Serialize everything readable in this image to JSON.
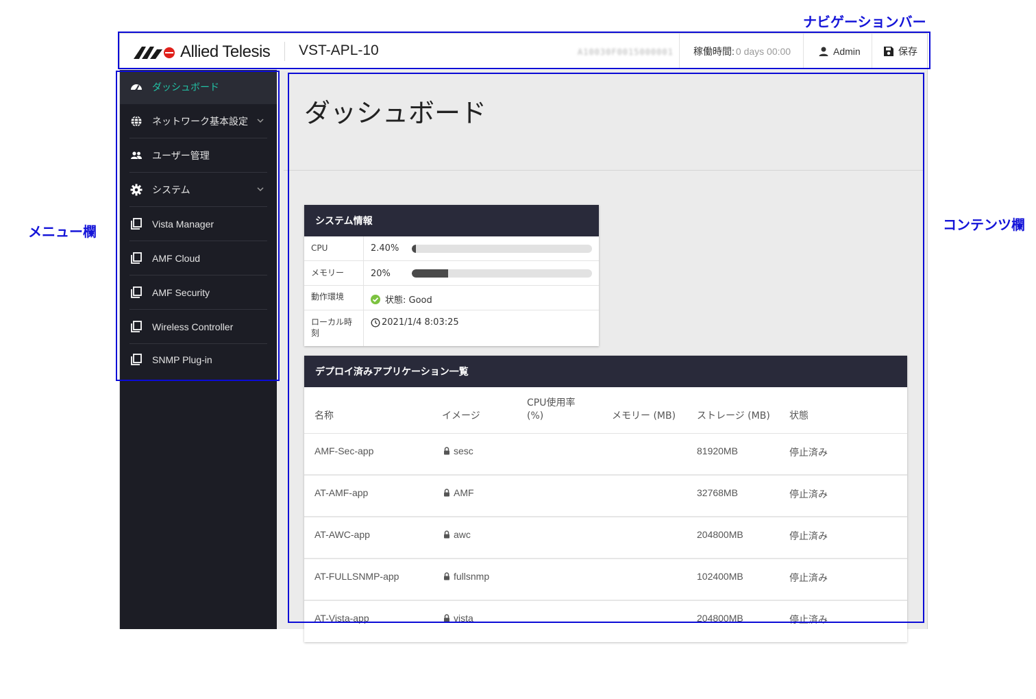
{
  "annotations": {
    "navbar_label": "ナビゲーションバー",
    "menu_label": "メニュー欄",
    "content_label": "コンテンツ欄"
  },
  "colors": {
    "accent": "#22c3a6",
    "sidebar_bg": "#1c1d25",
    "card_header": "#292a3a",
    "annotation": "#0a0ad6",
    "logo_red": "#e0201b"
  },
  "topbar": {
    "logo_text": "Allied Telesis",
    "device_name": "VST-APL-10",
    "serial": "A10030F0015000001",
    "uptime_label": "稼働時間:",
    "uptime_value": "0 days 00:00",
    "user_label": "Admin",
    "user_icon": "user-icon",
    "save_label": "保存",
    "save_icon": "floppy-disk-icon"
  },
  "sidebar": {
    "items": [
      {
        "label": "ダッシュボード",
        "icon": "speedometer-icon",
        "active": true
      },
      {
        "label": "ネットワーク基本設定",
        "icon": "globe-icon",
        "expandable": true
      },
      {
        "label": "ユーザー管理",
        "icon": "users-icon"
      },
      {
        "label": "システム",
        "icon": "gear-icon",
        "expandable": true
      },
      {
        "label": "Vista Manager",
        "icon": "app-window-icon"
      },
      {
        "label": "AMF Cloud",
        "icon": "app-window-icon"
      },
      {
        "label": "AMF Security",
        "icon": "app-window-icon"
      },
      {
        "label": "Wireless Controller",
        "icon": "app-window-icon"
      },
      {
        "label": "SNMP Plug-in",
        "icon": "app-window-icon"
      }
    ]
  },
  "main": {
    "title": "ダッシュボード",
    "system_info": {
      "title": "システム情報",
      "cpu_label": "CPU",
      "cpu_value": "2.40%",
      "cpu_fraction": 0.024,
      "memory_label": "メモリー",
      "memory_value": "20%",
      "memory_fraction": 0.2,
      "env_label": "動作環境",
      "env_value": "状態: Good",
      "time_label": "ローカル時刻",
      "time_value": "2021/1/4 8:03:25"
    },
    "apps": {
      "title": "デプロイ済みアプリケーション一覧",
      "columns": [
        "名称",
        "イメージ",
        "CPU使用率 (%)",
        "メモリー (MB)",
        "ストレージ (MB)",
        "状態"
      ],
      "rows": [
        {
          "name": "AMF-Sec-app",
          "image": "sesc",
          "cpu": "",
          "memory": "",
          "storage": "81920MB",
          "status": "停止済み"
        },
        {
          "name": "AT-AMF-app",
          "image": "AMF",
          "cpu": "",
          "memory": "",
          "storage": "32768MB",
          "status": "停止済み"
        },
        {
          "name": "AT-AWC-app",
          "image": "awc",
          "cpu": "",
          "memory": "",
          "storage": "204800MB",
          "status": "停止済み"
        },
        {
          "name": "AT-FULLSNMP-app",
          "image": "fullsnmp",
          "cpu": "",
          "memory": "",
          "storage": "102400MB",
          "status": "停止済み"
        },
        {
          "name": "AT-Vista-app",
          "image": "vista",
          "cpu": "",
          "memory": "",
          "storage": "204800MB",
          "status": "停止済み"
        }
      ]
    }
  }
}
